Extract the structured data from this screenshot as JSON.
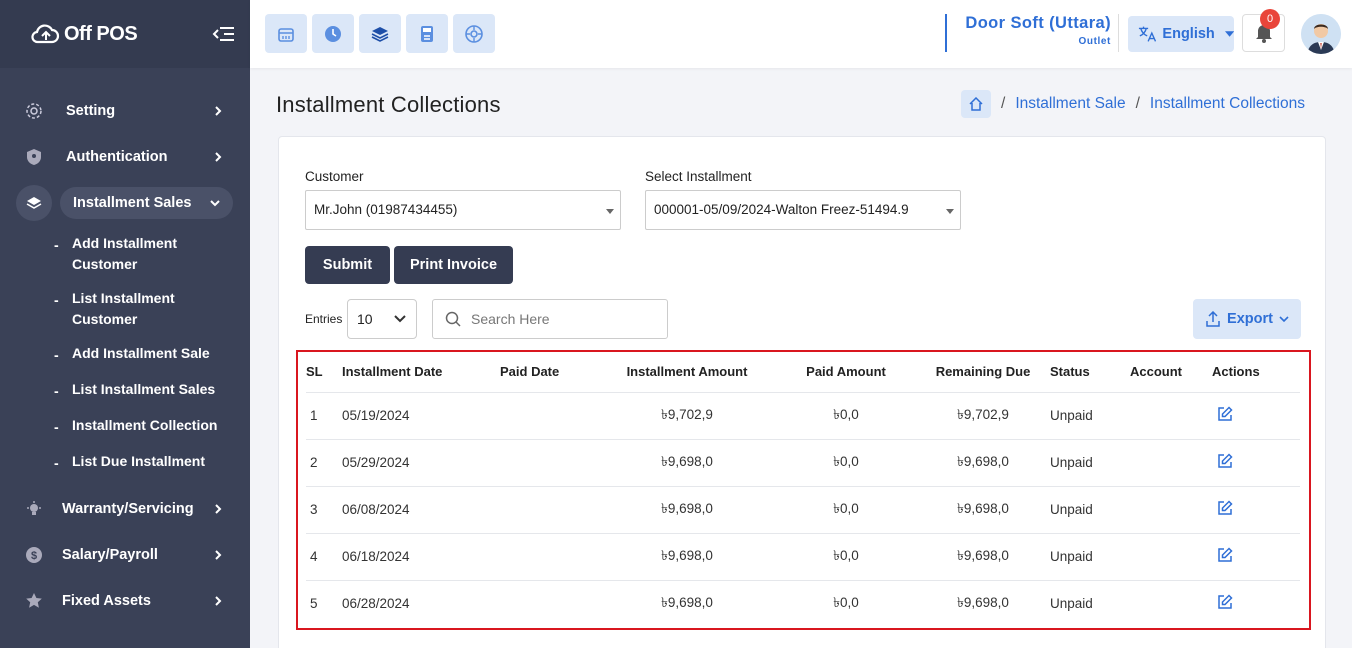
{
  "brand": {
    "name": "Off POS"
  },
  "sidebar": {
    "items_top": [
      {
        "label": "Setting",
        "icon": "gear-icon"
      },
      {
        "label": "Authentication",
        "icon": "shield-icon"
      }
    ],
    "active": {
      "label": "Installment Sales",
      "icon": "layers-icon"
    },
    "subitems": [
      "Add Installment Customer",
      "List Installment Customer",
      "Add Installment Sale",
      "List Installment Sales",
      "Installment Collection",
      "List Due Installment"
    ],
    "items_bottom": [
      {
        "label": "Warranty/Servicing",
        "icon": "bulb-icon"
      },
      {
        "label": "Salary/Payroll",
        "icon": "dollar-icon"
      },
      {
        "label": "Fixed Assets",
        "icon": "star-icon"
      }
    ]
  },
  "header": {
    "quick_icons": [
      "pos-icon",
      "clock-icon",
      "layers-icon",
      "calculator-icon",
      "register-icon"
    ],
    "store_name": "Door Soft (Uttara)",
    "store_type": "Outlet",
    "language": "English",
    "notification_count": "0"
  },
  "page": {
    "title": "Installment Collections",
    "breadcrumb": [
      "Installment Sale",
      "Installment Collections"
    ]
  },
  "form": {
    "customer_label": "Customer",
    "customer_value": "Mr.John (01987434455)",
    "installment_label": "Select Installment",
    "installment_value": "000001-05/09/2024-Walton Freez-51494.9",
    "submit_label": "Submit",
    "print_label": "Print Invoice"
  },
  "table_controls": {
    "entries_label": "Entries",
    "entries_value": "10",
    "search_placeholder": "Search Here",
    "export_label": "Export"
  },
  "table": {
    "headers": [
      "SL",
      "Installment Date",
      "Paid Date",
      "Installment Amount",
      "Paid Amount",
      "Remaining Due",
      "Status",
      "Account",
      "Actions"
    ],
    "rows": [
      {
        "sl": "1",
        "date": "05/19/2024",
        "paid_date": "",
        "amount": "৳9,702,9",
        "paid": "৳0,0",
        "due": "৳9,702,9",
        "status": "Unpaid",
        "account": ""
      },
      {
        "sl": "2",
        "date": "05/29/2024",
        "paid_date": "",
        "amount": "৳9,698,0",
        "paid": "৳0,0",
        "due": "৳9,698,0",
        "status": "Unpaid",
        "account": ""
      },
      {
        "sl": "3",
        "date": "06/08/2024",
        "paid_date": "",
        "amount": "৳9,698,0",
        "paid": "৳0,0",
        "due": "৳9,698,0",
        "status": "Unpaid",
        "account": ""
      },
      {
        "sl": "4",
        "date": "06/18/2024",
        "paid_date": "",
        "amount": "৳9,698,0",
        "paid": "৳0,0",
        "due": "৳9,698,0",
        "status": "Unpaid",
        "account": ""
      },
      {
        "sl": "5",
        "date": "06/28/2024",
        "paid_date": "",
        "amount": "৳9,698,0",
        "paid": "৳0,0",
        "due": "৳9,698,0",
        "status": "Unpaid",
        "account": ""
      }
    ]
  },
  "colors": {
    "sidebar": "#3a4157",
    "accent": "#2f6fd6",
    "highlight_border": "#d9161f"
  }
}
